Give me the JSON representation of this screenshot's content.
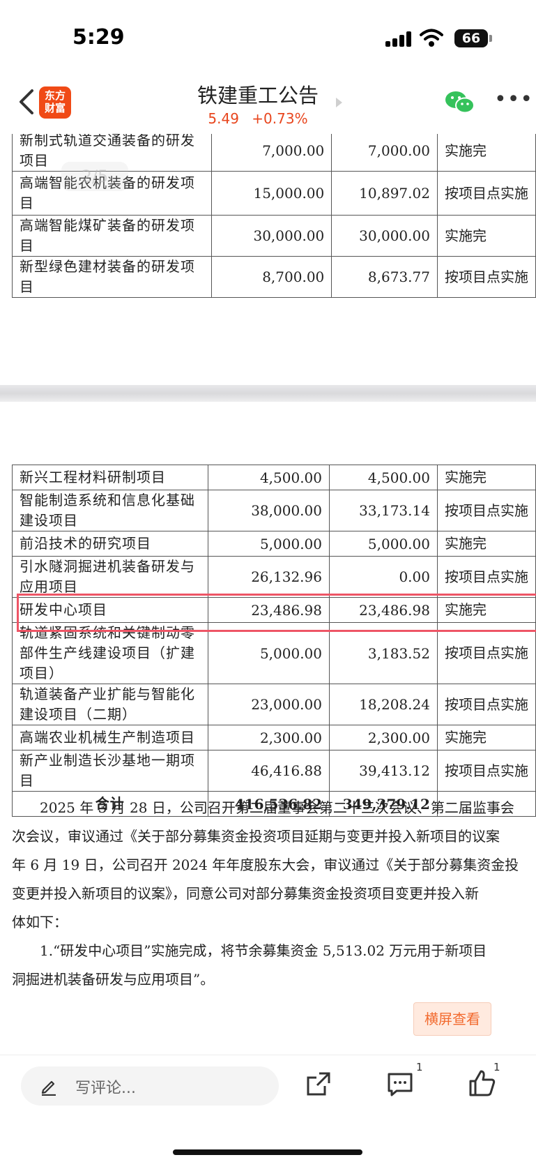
{
  "status_bar": {
    "time": "5:29",
    "battery": "66"
  },
  "header": {
    "logo_line1": "东方",
    "logo_line2": "财富",
    "title": "铁建重工公告",
    "price": "5.49",
    "change": "+0.73%"
  },
  "watermark": "2/5",
  "table_top": [
    {
      "name": "新制式轨道交通装备的研发项目",
      "planned": "7,000.00",
      "used": "7,000.00",
      "status": "实施完"
    },
    {
      "name": "高端智能农机装备的研发项目",
      "planned": "15,000.00",
      "used": "10,897.02",
      "status": "按项目点实施"
    },
    {
      "name": "高端智能煤矿装备的研发项目",
      "planned": "30,000.00",
      "used": "30,000.00",
      "status": "实施完"
    },
    {
      "name": "新型绿色建材装备的研发项目",
      "planned": "8,700.00",
      "used": "8,673.77",
      "status": "按项目点实施"
    }
  ],
  "table_bottom": [
    {
      "name": "新兴工程材料研制项目",
      "planned": "4,500.00",
      "used": "4,500.00",
      "status": "实施完"
    },
    {
      "name": "智能制造系统和信息化基础建设项目",
      "planned": "38,000.00",
      "used": "33,173.14",
      "status": "按项目点实施"
    },
    {
      "name": "前沿技术的研究项目",
      "planned": "5,000.00",
      "used": "5,000.00",
      "status": "实施完"
    },
    {
      "name": "引水隧洞掘进机装备研发与应用项目",
      "planned": "26,132.96",
      "used": "0.00",
      "status": "按项目点实施"
    },
    {
      "name": "研发中心项目",
      "planned": "23,486.98",
      "used": "23,486.98",
      "status": "实施完"
    },
    {
      "name": "轨道紧固系统和关键制动零部件生产线建设项目（扩建项目）",
      "planned": "5,000.00",
      "used": "3,183.52",
      "status": "按项目点实施"
    },
    {
      "name": "轨道装备产业扩能与智能化建设项目（二期）",
      "planned": "23,000.00",
      "used": "18,208.24",
      "status": "按项目点实施"
    },
    {
      "name": "高端农业机械生产制造项目",
      "planned": "2,300.00",
      "used": "2,300.00",
      "status": "实施完"
    },
    {
      "name": "新产业制造长沙基地一期项目",
      "planned": "46,416.88",
      "used": "39,413.12",
      "status": "按项目点实施"
    }
  ],
  "total": {
    "label": "合计",
    "planned": "416,536.82",
    "used": "349,379.12"
  },
  "paragraph_lines": [
    "　　2025 年 3 月 28 日，公司召开第二届董事会第二十三次会议、第二届监事会",
    "次会议，审议通过《关于部分募集资金投资项目延期与变更并投入新项目的议案",
    "年 6 月 19 日，公司召开 2024 年年度股东大会，审议通过《关于部分募集资金投",
    "变更并投入新项目的议案》，同意公司对部分募集资金投资项目变更并投入新",
    "体如下：",
    "　　1.“研发中心项目”实施完成，将节余募集资金 5,513.02 万元用于新项目",
    "洞掘进机装备研发与应用项目”。"
  ],
  "landscape_button": "横屏查看",
  "bottom_bar": {
    "comment_placeholder": "写评论...",
    "comment_count": "1",
    "like_count": "1"
  }
}
